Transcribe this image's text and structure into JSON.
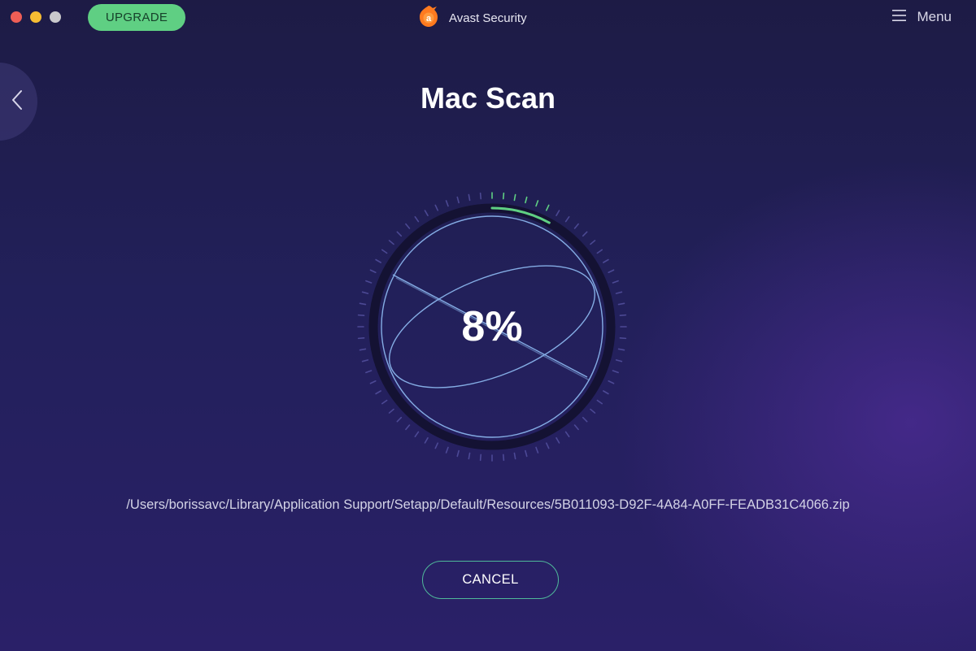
{
  "window": {
    "controls": [
      "close",
      "minimize",
      "maximize"
    ]
  },
  "header": {
    "upgrade_label": "UPGRADE",
    "app_title": "Avast Security",
    "menu_label": "Menu",
    "logo_icon": "avast-logo-icon",
    "menu_icon": "hamburger-icon"
  },
  "nav": {
    "back_icon": "chevron-left-icon"
  },
  "main": {
    "title": "Mac Scan",
    "progress_percent": 8,
    "progress_text": "8%",
    "current_file": "/Users/borissavc/Library/Application Support/Setapp/Default/Resources/5B011093-D92F-4A84-A0FF-FEADB31C4066.zip",
    "cancel_label": "CANCEL"
  },
  "colors": {
    "accent_green": "#5fcf83",
    "cancel_border": "#4fb89a",
    "orb_line": "#8ab4ec",
    "brand_orange": "#ff7a1f",
    "background": "#1d1b45"
  }
}
